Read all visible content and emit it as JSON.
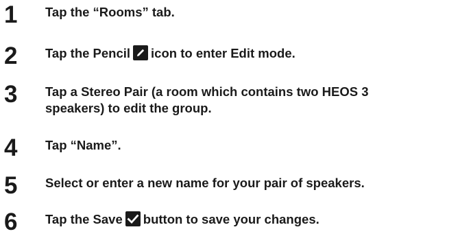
{
  "steps": [
    {
      "number": "1",
      "text": "Tap the “Rooms” tab."
    },
    {
      "number": "2",
      "text_before": "Tap the Pencil",
      "icon": "pencil-icon",
      "text_after": "icon to enter Edit mode."
    },
    {
      "number": "3",
      "line1": "Tap a Stereo Pair (a room which contains two HEOS 3",
      "line2": "speakers) to edit the group."
    },
    {
      "number": "4",
      "text": "Tap “Name”."
    },
    {
      "number": "5",
      "text": "Select or enter a new name for your pair of speakers."
    },
    {
      "number": "6",
      "text_before": "Tap the Save",
      "icon": "checkmark-icon",
      "text_after": "button to save your changes."
    }
  ]
}
